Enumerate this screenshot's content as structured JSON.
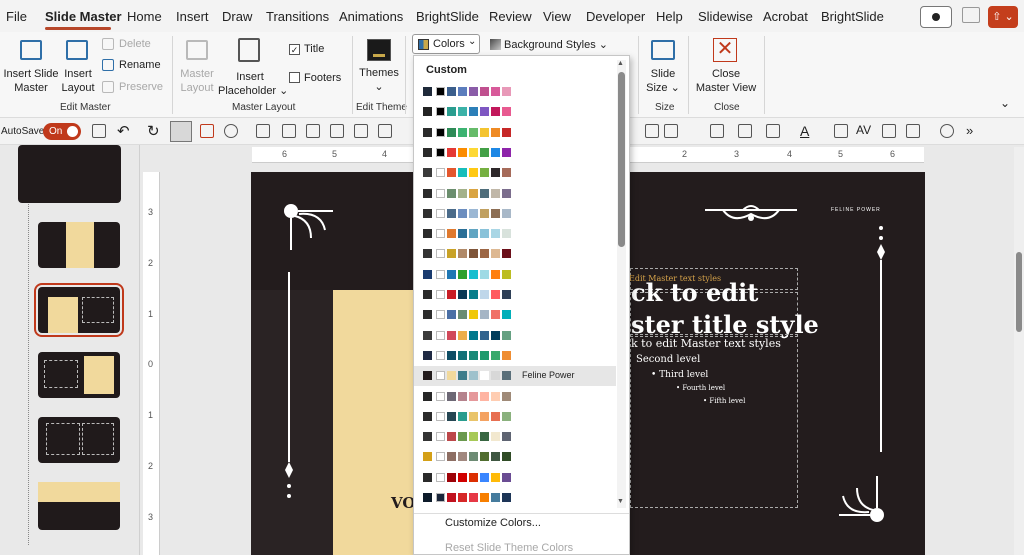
{
  "menu": {
    "tabs": [
      "File",
      "Slide Master",
      "Home",
      "Insert",
      "Draw",
      "Transitions",
      "Animations",
      "BrightSlide",
      "Review",
      "View",
      "Developer",
      "Help",
      "Slidewise",
      "Acrobat",
      "BrightSlide"
    ],
    "active": "Slide Master"
  },
  "ribbon": {
    "insert_slide_master": [
      "Insert Slide",
      "Master"
    ],
    "insert_layout": [
      "Insert",
      "Layout"
    ],
    "delete": "Delete",
    "rename": "Rename",
    "preserve": "Preserve",
    "group_edit_master": "Edit Master",
    "master_layout": [
      "Master",
      "Layout"
    ],
    "insert_placeholder": [
      "Insert",
      "Placeholder"
    ],
    "title_checkbox": "Title",
    "footers_checkbox": "Footers",
    "group_master_layout": "Master Layout",
    "themes": "Themes",
    "group_edit_theme": "Edit Theme",
    "colors": "Colors",
    "background_styles": "Background Styles",
    "slide_size": [
      "Slide",
      "Size"
    ],
    "group_size": "Size",
    "close_master_view": [
      "Close",
      "Master View"
    ],
    "group_close": "Close"
  },
  "qat": {
    "autosave": "AutoSave",
    "toggle": "On",
    "more": "»"
  },
  "dropdown": {
    "header": "Custom",
    "hover_name": "Feline Power",
    "customize": "Customize Colors...",
    "reset": "Reset Slide Theme Colors",
    "palettes": [
      [
        "#1f2a3a",
        "#000000",
        "#3b5e8c",
        "#5b7dbd",
        "#8a5ca8",
        "#c0508f",
        "#d85a9a",
        "#e899b8"
      ],
      [
        "#232323",
        "#000000",
        "#2a9d8f",
        "#3bb2a8",
        "#2c7fb8",
        "#7e57c2",
        "#c2185b",
        "#e85a90"
      ],
      [
        "#2b2b2b",
        "#000000",
        "#2e8b57",
        "#3cb371",
        "#66bb6a",
        "#f4c430",
        "#ef8a24",
        "#c62828"
      ],
      [
        "#2a2a2a",
        "#000000",
        "#e53935",
        "#fb8c00",
        "#fdd835",
        "#43a047",
        "#1e88e5",
        "#8e24aa"
      ],
      [
        "#3a3a3a",
        "#ffffff",
        "#e4572e",
        "#17bebb",
        "#ffc914",
        "#76b041",
        "#2e282a",
        "#a66b5a"
      ],
      [
        "#2b2b2b",
        "#ffffff",
        "#6b8e6e",
        "#a3b18a",
        "#d9a441",
        "#4f6d7a",
        "#c0b7a8",
        "#7b6d8d"
      ],
      [
        "#2f2f2f",
        "#ffffff",
        "#4b6b8a",
        "#6c8ebf",
        "#9bb7d4",
        "#c0a060",
        "#8c6e54",
        "#a8b8c8"
      ],
      [
        "#2b2b2b",
        "#ffffff",
        "#e07a2f",
        "#2a6f97",
        "#61a5c2",
        "#89c2d9",
        "#a9d6e5",
        "#d8e2dc"
      ],
      [
        "#333333",
        "#ffffff",
        "#c9a227",
        "#b08968",
        "#7f5539",
        "#9c6644",
        "#ddb892",
        "#6b0f1a"
      ],
      [
        "#1a3b6f",
        "#ffffff",
        "#1f77b4",
        "#2ca02c",
        "#17becf",
        "#9edae5",
        "#ff7f0e",
        "#bcbd22"
      ],
      [
        "#2a2a2a",
        "#ffffff",
        "#c81d25",
        "#0b3954",
        "#087e8b",
        "#bfd7ea",
        "#ff5a5f",
        "#2e4057"
      ],
      [
        "#2d2d2d",
        "#ffffff",
        "#4a6fa5",
        "#6a8d73",
        "#f0c808",
        "#a5b5c5",
        "#f07167",
        "#00afb9"
      ],
      [
        "#3b3b3b",
        "#ffffff",
        "#d1495b",
        "#edae49",
        "#00798c",
        "#30638e",
        "#003d5b",
        "#66a182"
      ],
      [
        "#202a44",
        "#ffffff",
        "#0e4d64",
        "#137177",
        "#188977",
        "#1d9a6c",
        "#39a96b",
        "#ef8d32"
      ],
      [
        "#231c1d",
        "#ffffff",
        "#f1d99c",
        "#3d7b8a",
        "#9ec1cc",
        "#ffffff",
        "#d8d8d8",
        "#5a6f7a"
      ],
      [
        "#262626",
        "#ffffff",
        "#6d6875",
        "#b5838d",
        "#e5989b",
        "#ffb4a2",
        "#ffcdb2",
        "#9f8a78"
      ],
      [
        "#2b2b2b",
        "#ffffff",
        "#264653",
        "#2a9d8f",
        "#e9c46a",
        "#f4a261",
        "#e76f51",
        "#8ab17d"
      ],
      [
        "#333333",
        "#ffffff",
        "#bc4749",
        "#6a994e",
        "#a7c957",
        "#386641",
        "#f2e8cf",
        "#5e6472"
      ],
      [
        "#d4a017",
        "#ffffff",
        "#8d6e63",
        "#a1887f",
        "#6d8b74",
        "#506d2f",
        "#3e5641",
        "#2f4b26"
      ],
      [
        "#2a2a2a",
        "#ffffff",
        "#9d0208",
        "#d00000",
        "#dc2f02",
        "#3a86ff",
        "#ffba08",
        "#6a4c93"
      ],
      [
        "#0d1b2a",
        "#1b263b",
        "#c1121f",
        "#d62828",
        "#e63946",
        "#f77f00",
        "#457b9d",
        "#1d3557"
      ]
    ]
  },
  "slide": {
    "feline_power": "FELINE POWER",
    "click_edit_text_small": "Edit Master text styles",
    "title_line1": "ck to edit",
    "title_line2": "ster title style",
    "body_first": "k to edit Master text styles",
    "level2": "Second level",
    "level3": "Third level",
    "level4": "Fourth level",
    "level5": "Fifth level",
    "vo": "VO"
  },
  "rulers": {
    "h": [
      "6",
      "5",
      "4",
      "3",
      "2",
      "1",
      "0",
      "1",
      "2",
      "3",
      "4",
      "5",
      "6"
    ],
    "v": [
      "3",
      "2",
      "1",
      "0",
      "1",
      "2",
      "3"
    ]
  }
}
